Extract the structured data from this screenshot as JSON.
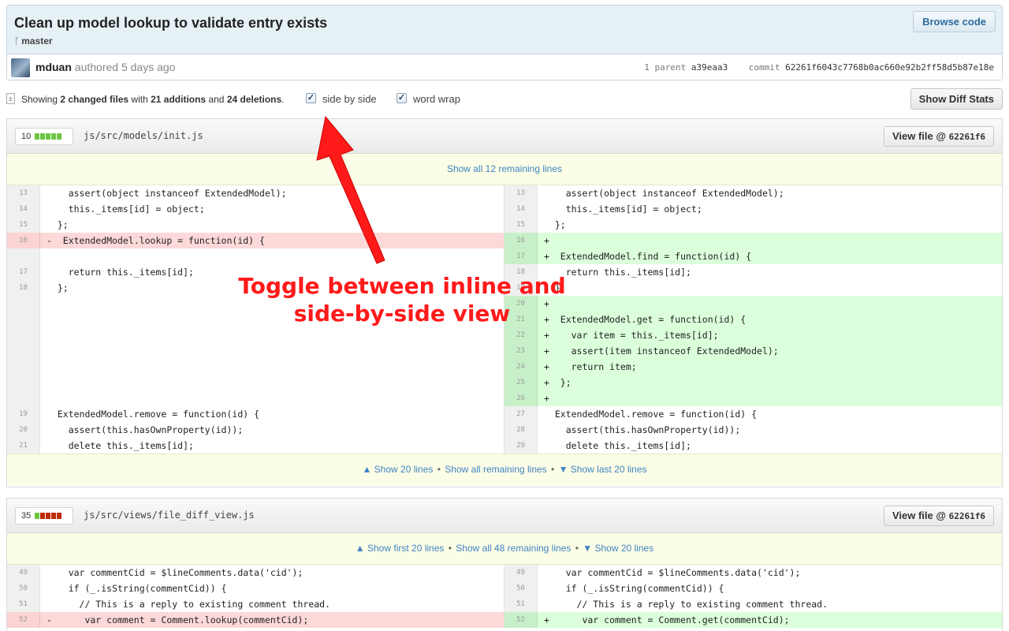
{
  "commit": {
    "title": "Clean up model lookup to validate entry exists",
    "branch": "master",
    "browse_label": "Browse code",
    "author": "mduan",
    "authored": "authored 5 days ago",
    "parent_label": "1 parent",
    "parent_sha": "a39eaa3",
    "commit_label": "commit",
    "commit_sha": "62261f6043c7768b0ac660e92b2ff58d5b87e18e"
  },
  "toolbar": {
    "showing_prefix": "Showing ",
    "changed_files": "2 changed files",
    "with": " with ",
    "additions": "21 additions",
    "and": " and ",
    "deletions": "24 deletions",
    "period": ".",
    "side_by_side_label": "side by side",
    "side_by_side_checked": true,
    "word_wrap_label": "word wrap",
    "word_wrap_checked": true,
    "diff_stats_label": "Show Diff Stats"
  },
  "files": [
    {
      "count": "10",
      "path": "js/src/models/init.js",
      "view_label": "View file @",
      "view_sha": "62261f6",
      "top_expander": "Show all 12 remaining lines",
      "bottom_expander": {
        "left": "▲ Show 20 lines",
        "middle": "Show all remaining lines",
        "right": "▼ Show last 20 lines"
      },
      "left_rows": [
        {
          "ln": "13",
          "type": "ctx",
          "code": "    assert(object instanceof ExtendedModel);"
        },
        {
          "ln": "14",
          "type": "ctx",
          "code": "    this._items[id] = object;"
        },
        {
          "ln": "15",
          "type": "ctx",
          "code": "  };"
        },
        {
          "ln": "16",
          "type": "del",
          "code": "-  ExtendedModel.lookup = function(id) {"
        },
        {
          "ln": "",
          "type": "empty",
          "code": ""
        },
        {
          "ln": "17",
          "type": "ctx",
          "code": "    return this._items[id];"
        },
        {
          "ln": "18",
          "type": "ctx",
          "code": "  };"
        },
        {
          "ln": "19",
          "type": "ctx",
          "code": "  ExtendedModel.remove = function(id) {"
        },
        {
          "ln": "20",
          "type": "ctx",
          "code": "    assert(this.hasOwnProperty(id));"
        },
        {
          "ln": "21",
          "type": "ctx",
          "code": "    delete this._items[id];"
        }
      ],
      "right_rows": [
        {
          "ln": "13",
          "type": "ctx",
          "code": "    assert(object instanceof ExtendedModel);"
        },
        {
          "ln": "14",
          "type": "ctx",
          "code": "    this._items[id] = object;"
        },
        {
          "ln": "15",
          "type": "ctx",
          "code": "  };"
        },
        {
          "ln": "16",
          "type": "add",
          "code": "+"
        },
        {
          "ln": "17",
          "type": "add",
          "code": "+  ExtendedModel.find = function(id) {"
        },
        {
          "ln": "18",
          "type": "ctx",
          "code": "    return this._items[id];"
        },
        {
          "ln": "19",
          "type": "ctx",
          "code": "  };"
        },
        {
          "ln": "20",
          "type": "add",
          "code": "+"
        },
        {
          "ln": "21",
          "type": "add",
          "code": "+  ExtendedModel.get = function(id) {"
        },
        {
          "ln": "22",
          "type": "add",
          "code": "+    var item = this._items[id];"
        },
        {
          "ln": "23",
          "type": "add",
          "code": "+    assert(item instanceof ExtendedModel);"
        },
        {
          "ln": "24",
          "type": "add",
          "code": "+    return item;"
        },
        {
          "ln": "25",
          "type": "add",
          "code": "+  };"
        },
        {
          "ln": "26",
          "type": "add",
          "code": "+"
        },
        {
          "ln": "27",
          "type": "ctx",
          "code": "  ExtendedModel.remove = function(id) {"
        },
        {
          "ln": "28",
          "type": "ctx",
          "code": "    assert(this.hasOwnProperty(id));"
        },
        {
          "ln": "29",
          "type": "ctx",
          "code": "    delete this._items[id];"
        }
      ]
    },
    {
      "count": "35",
      "path": "js/src/views/file_diff_view.js",
      "view_label": "View file @",
      "view_sha": "62261f6",
      "top_expander": {
        "left": "▲ Show first 20 lines",
        "middle": "Show all 48 remaining lines",
        "right": "▼ Show 20 lines"
      },
      "left_rows": [
        {
          "ln": "49",
          "type": "ctx",
          "code": "    var commentCid = $lineComments.data('cid');"
        },
        {
          "ln": "50",
          "type": "ctx",
          "code": "    if (_.isString(commentCid)) {"
        },
        {
          "ln": "51",
          "type": "ctx",
          "code": "      // This is a reply to existing comment thread."
        },
        {
          "ln": "52",
          "type": "del",
          "code": "-      var comment = Comment.lookup(commentCid);"
        }
      ],
      "right_rows": [
        {
          "ln": "49",
          "type": "ctx",
          "code": "    var commentCid = $lineComments.data('cid');"
        },
        {
          "ln": "50",
          "type": "ctx",
          "code": "    if (_.isString(commentCid)) {"
        },
        {
          "ln": "51",
          "type": "ctx",
          "code": "      // This is a reply to existing comment thread."
        },
        {
          "ln": "52",
          "type": "add",
          "code": "+      var comment = Comment.get(commentCid);"
        }
      ]
    }
  ],
  "annotation": {
    "line1": "Toggle between inline and",
    "line2": "side-by-side view",
    "color": "#ff1a1a"
  },
  "colors": {
    "addition": "#dbffdb",
    "deletion": "#fdd8d8",
    "link": "#4183c4",
    "diffstat_green": "#6cc644",
    "diffstat_red": "#bd2c00"
  },
  "icons": {
    "branch": "branch-icon",
    "diff": "diff-icon",
    "checkbox": "checkmark-icon",
    "arrow": "arrow-icon"
  }
}
